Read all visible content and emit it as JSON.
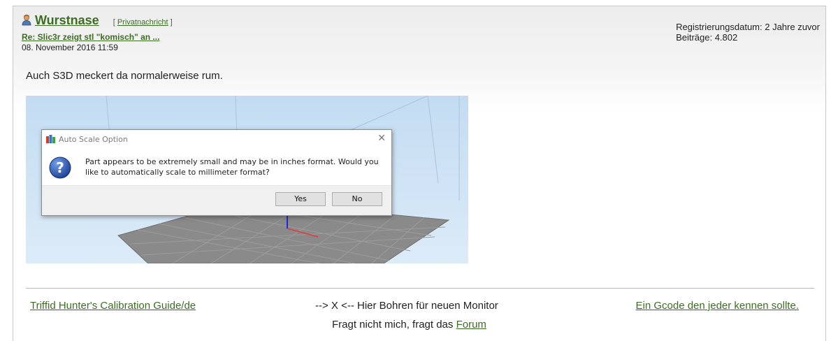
{
  "post": {
    "author": "Wurstnase",
    "pm_label": "Privatnachricht",
    "subject": "Re: Slic3r zeigt stl \"komisch\" an ...",
    "date": "08. November 2016 11:59",
    "registration": "Registrierungsdatum: 2 Jahre zuvor",
    "posts_count": "Beiträge: 4.802",
    "text": "Auch S3D meckert da normalerweise rum."
  },
  "dialog": {
    "title": "Auto Scale Option",
    "message": "Part appears to be extremely small and may be in inches format.  Would you like to automatically scale to millimeter format?",
    "yes_label": "Yes",
    "no_label": "No",
    "close_glyph": "✕"
  },
  "signature": {
    "left_link": "Triffid Hunter's Calibration Guide/de",
    "center_text": "--> X <-- Hier Bohren für neuen Monitor",
    "right_link": "Ein Gcode den jeder kennen sollte.",
    "line2_prefix": "Fragt nicht mich, fragt das",
    "line2_link": "Forum"
  },
  "colors": {
    "link": "#3b6e22",
    "viewport_bg": "#cde3f5",
    "build_plate": "#8a8a8a"
  },
  "icons": [
    "user-icon",
    "app-icon",
    "close-icon",
    "question-icon"
  ]
}
